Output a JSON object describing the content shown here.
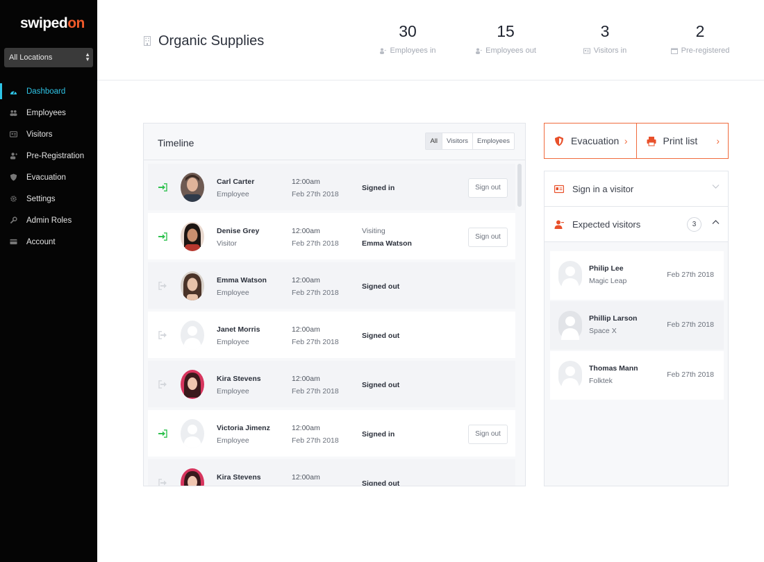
{
  "brand": {
    "logo_main": "swiped",
    "logo_accent": "on",
    "accent_color": "#f05a2a",
    "active_color": "#2ec4e6"
  },
  "location_select": {
    "value": "All Locations"
  },
  "sidebar": {
    "items": [
      {
        "label": "Dashboard",
        "icon": "dashboard-icon",
        "active": true
      },
      {
        "label": "Employees",
        "icon": "employees-icon"
      },
      {
        "label": "Visitors",
        "icon": "visitors-icon"
      },
      {
        "label": "Pre-Registration",
        "icon": "pre-registration-icon"
      },
      {
        "label": "Evacuation",
        "icon": "shield-icon"
      },
      {
        "label": "Settings",
        "icon": "gear-icon"
      },
      {
        "label": "Admin Roles",
        "icon": "wrench-icon"
      },
      {
        "label": "Account",
        "icon": "card-icon"
      }
    ]
  },
  "header": {
    "title": "Organic Supplies",
    "stats": [
      {
        "value": "30",
        "label": "Employees in"
      },
      {
        "value": "15",
        "label": "Employees out"
      },
      {
        "value": "3",
        "label": "Visitors in"
      },
      {
        "value": "2",
        "label": "Pre-registered"
      }
    ]
  },
  "timeline": {
    "title": "Timeline",
    "filters": [
      "All",
      "Visitors",
      "Employees"
    ],
    "sign_out_label": "Sign out",
    "rows": [
      {
        "name": "Carl Carter",
        "role": "Employee",
        "time": "12:00am",
        "date": "Feb 27th 2018",
        "status": "Signed in"
      },
      {
        "name": "Denise Grey",
        "role": "Visitor",
        "time": "12:00am",
        "date": "Feb 27th 2018",
        "status_top": "Visiting",
        "status_bottom": "Emma Watson"
      },
      {
        "name": "Emma Watson",
        "role": "Employee",
        "time": "12:00am",
        "date": "Feb 27th 2018",
        "status": "Signed out"
      },
      {
        "name": "Janet Morris",
        "role": "Employee",
        "time": "12:00am",
        "date": "Feb 27th 2018",
        "status": "Signed out"
      },
      {
        "name": "Kira Stevens",
        "role": "Employee",
        "time": "12:00am",
        "date": "Feb 27th 2018",
        "status": "Signed out"
      },
      {
        "name": "Victoria Jimenz",
        "role": "Employee",
        "time": "12:00am",
        "date": "Feb 27th 2018",
        "status": "Signed in"
      },
      {
        "name": "Kira Stevens",
        "role": "",
        "time": "12:00am",
        "date": "",
        "status": "Signed out"
      }
    ]
  },
  "actions": {
    "evacuation": "Evacuation",
    "print": "Print list"
  },
  "visitor_panel": {
    "sign_in_label": "Sign in a visitor",
    "expected_label": "Expected visitors",
    "expected_count": "3",
    "expected": [
      {
        "name": "Philip Lee",
        "company": "Magic Leap",
        "date": "Feb 27th 2018"
      },
      {
        "name": "Phillip Larson",
        "company": "Space X",
        "date": "Feb 27th 2018"
      },
      {
        "name": "Thomas Mann",
        "company": "Folktek",
        "date": "Feb 27th 2018"
      }
    ]
  }
}
